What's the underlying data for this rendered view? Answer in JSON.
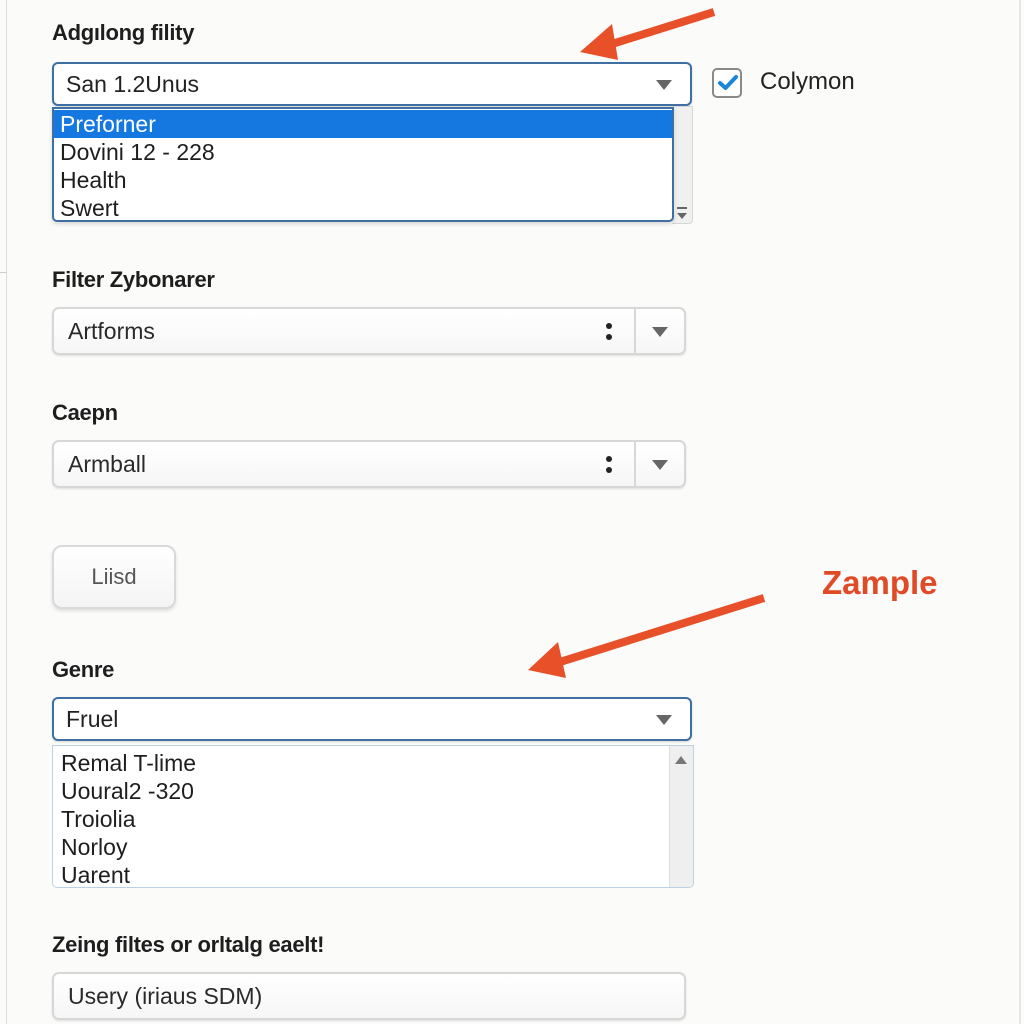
{
  "section1": {
    "label": "Adgılong fility",
    "select_value": "San 1.2Unus",
    "options": [
      {
        "label": "Preforner",
        "selected": true
      },
      {
        "label": "Dovini 12 - 228",
        "selected": false
      },
      {
        "label": "Health",
        "selected": false
      },
      {
        "label": "Swert",
        "selected": false
      }
    ],
    "checkbox": {
      "label": "Colymon",
      "checked": true
    }
  },
  "section2": {
    "label": "Filter  Zybonarer",
    "value": "Artforms"
  },
  "section3": {
    "label": "Caepn",
    "value": "Armball"
  },
  "button": {
    "label": "Liisd"
  },
  "annotation": {
    "text": "Zample",
    "color": "#e04a26"
  },
  "genre": {
    "label": "Genre",
    "select_value": "Fruel",
    "options": [
      {
        "label": "Remal T-lime"
      },
      {
        "label": "Uoural2 -320"
      },
      {
        "label": "Troiolia"
      },
      {
        "label": "Norloy"
      },
      {
        "label": "Uarent"
      }
    ]
  },
  "footer_field": {
    "label": "Zeing filtes or orltalg eaelt!",
    "value": "Usery (iriaus SDM)"
  },
  "colors": {
    "accent": "#1478e0",
    "focus_border": "#3f6fa3",
    "annotation": "#e04a26"
  }
}
